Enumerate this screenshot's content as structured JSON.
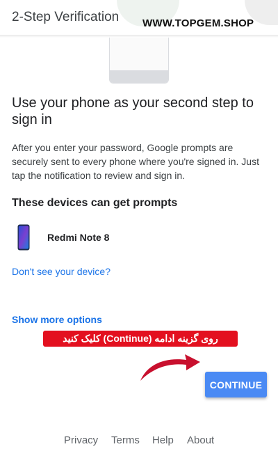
{
  "header": {
    "title": "2-Step Verification"
  },
  "watermark": "WWW.TOPGEM.SHOP",
  "main": {
    "title": "Use your phone as your second step to sign in",
    "description": "After you enter your password, Google prompts are securely sent to every phone where you're signed in. Just tap the notification to review and sign in.",
    "devices_heading": "These devices can get prompts",
    "devices": [
      {
        "name": "Redmi Note 8",
        "icon": "smartphone-icon"
      }
    ],
    "dont_see_device_link": "Don't see your device?",
    "show_more_link": "Show more options"
  },
  "annotation": {
    "text": "روی گزینه ادامه (Continue) کلیک کنید",
    "color": "#e3101f",
    "arrow_color": "#c8102e"
  },
  "actions": {
    "continue_label": "CONTINUE",
    "continue_color": "#4a8af4"
  },
  "footer": {
    "privacy": "Privacy",
    "terms": "Terms",
    "help": "Help",
    "about": "About"
  }
}
